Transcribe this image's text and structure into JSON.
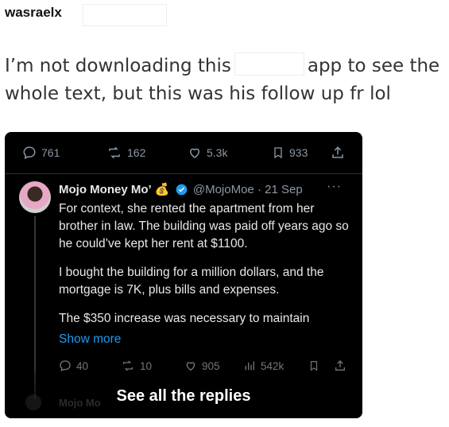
{
  "post": {
    "username": "wasraelx",
    "text_before": "I’m not downloading this",
    "text_after": "app to see the whole text, but this was his follow up fr lol"
  },
  "screenshot": {
    "top_actions": {
      "replies": "761",
      "reposts": "162",
      "likes": "5.3k",
      "bookmarks": "933"
    },
    "reply": {
      "author_name": "Mojo Money Mo’",
      "author_emoji": "💰",
      "handle": "@MojoMoe",
      "date": "· 21 Sep",
      "more": "···",
      "paragraphs": [
        "For context, she rented the apartment from her brother in law. The building was paid off years ago so he could’ve kept her rent at $1100.",
        "I bought the building for a million dollars, and the mortgage is 7K, plus bills and expenses.",
        "The $350 increase was necessary to maintain"
      ],
      "show_more": "Show more",
      "stats": {
        "replies": "40",
        "reposts": "10",
        "likes": "905",
        "views": "542k"
      }
    },
    "faded_name": "Mojo Mo",
    "see_all": "See all the replies",
    "colors": {
      "accent": "#1d9bf0",
      "verified": "#1d9bf0"
    }
  }
}
